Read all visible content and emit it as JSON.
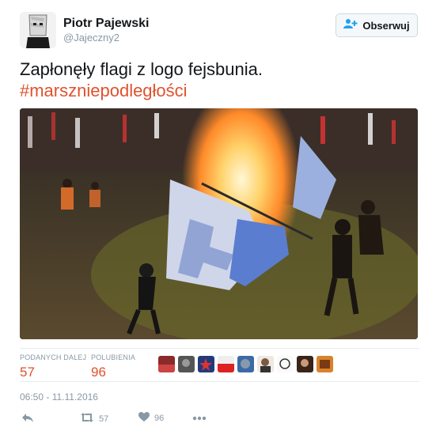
{
  "user": {
    "name": "Piotr Pajewski",
    "handle": "@Jajeczny2"
  },
  "follow_button": {
    "label": "Obserwuj"
  },
  "tweet": {
    "text": "Zapłonęły flagi z logo fejsbunia.",
    "hashtag": "#marszniepodległości",
    "timestamp": "06:50 - 11.11.2016"
  },
  "stats": {
    "retweets_label": "PODANYCH DALEJ",
    "retweets_value": "57",
    "likes_label": "POLUBIENIA",
    "likes_value": "96"
  },
  "actions": {
    "retweet_count": "57",
    "like_count": "96"
  },
  "colors": {
    "accent": "#e0522d",
    "muted": "#8899a6"
  }
}
